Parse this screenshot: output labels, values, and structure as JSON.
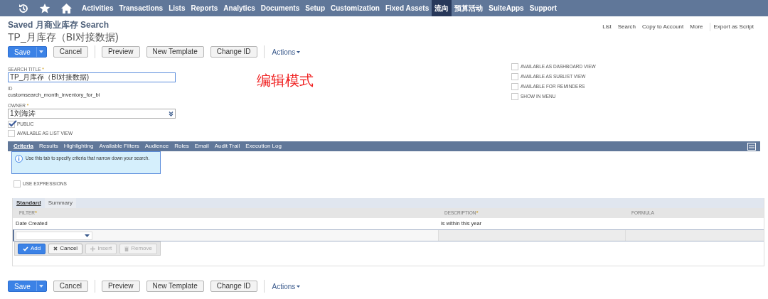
{
  "nav": {
    "icons": [
      {
        "kind": "history"
      },
      {
        "kind": "star"
      },
      {
        "kind": "home"
      }
    ],
    "items": [
      {
        "label": "Activities",
        "selected": false
      },
      {
        "label": "Transactions",
        "selected": false
      },
      {
        "label": "Lists",
        "selected": false
      },
      {
        "label": "Reports",
        "selected": false
      },
      {
        "label": "Analytics",
        "selected": false
      },
      {
        "label": "Documents",
        "selected": false
      },
      {
        "label": "Setup",
        "selected": false
      },
      {
        "label": "Customization",
        "selected": false
      },
      {
        "label": "Fixed Assets",
        "selected": false
      },
      {
        "label": "流向",
        "selected": true
      },
      {
        "label": "预算活动",
        "selected": false
      },
      {
        "label": "SuiteApps",
        "selected": false
      },
      {
        "label": "Support",
        "selected": false
      }
    ]
  },
  "page_title": "Saved 月商业库存 Search",
  "record_name": "TP_月库存（BI对接数据)",
  "header_links": [
    "List",
    "Search",
    "Copy to Account",
    "More",
    "Export as Script"
  ],
  "top_buttons": [
    {
      "kind": "primary",
      "label": "Save"
    },
    {
      "kind": "default",
      "label": "Cancel"
    },
    {
      "kind": "separator"
    },
    {
      "kind": "default",
      "label": "Preview"
    },
    {
      "kind": "default",
      "label": "New Template"
    },
    {
      "kind": "default",
      "label": "Change ID"
    },
    {
      "kind": "separator"
    },
    {
      "kind": "menu",
      "label": "Actions"
    }
  ],
  "fields": {
    "search_title": {
      "label": "SEARCH TITLE",
      "mark": "*",
      "value": "TP_月库存（BI对接数据)"
    },
    "id": {
      "label": "ID",
      "value": "customsearch_month_inventory_for_bi"
    },
    "owner": {
      "label": "OWNER",
      "mark": "*",
      "value": "1刘海涛"
    }
  },
  "left_checks": [
    {
      "label": "PUBLIC",
      "checked": true
    },
    {
      "label": "AVAILABLE AS LIST VIEW",
      "checked": false
    }
  ],
  "right_checks": [
    {
      "label": "AVAILABLE AS DASHBOARD VIEW",
      "checked": false
    },
    {
      "label": "AVAILABLE AS SUBLIST VIEW",
      "checked": false
    },
    {
      "label": "AVAILABLE FOR REMINDERS",
      "checked": false
    },
    {
      "label": "SHOW IN MENU",
      "checked": false
    }
  ],
  "annotation": "编辑模式",
  "tabs": [
    {
      "label": "Criteria",
      "selected": true
    },
    {
      "label": "Results",
      "selected": false
    },
    {
      "label": "Highlighting",
      "selected": false
    },
    {
      "label": "Available Filters",
      "selected": false
    },
    {
      "label": "Audience",
      "selected": false
    },
    {
      "label": "Roles",
      "selected": false
    },
    {
      "label": "Email",
      "selected": false
    },
    {
      "label": "Audit Trail",
      "selected": false
    },
    {
      "label": "Execution Log",
      "selected": false
    }
  ],
  "info": "Use this tab to specify criteria that narrow down your search.",
  "use_expressions": {
    "label": "USE EXPRESSIONS",
    "checked": false
  },
  "subtabs": [
    {
      "label": "Standard",
      "selected": true
    },
    {
      "label": "Summary",
      "selected": false
    }
  ],
  "table": {
    "columns": [
      {
        "label": "FILTER",
        "mark": "*"
      },
      {
        "label": "DESCRIPTION",
        "mark": "*"
      },
      {
        "label": "FORMULA"
      }
    ],
    "rows": [
      [
        "Date Created",
        "is within this year",
        ""
      ]
    ]
  },
  "row_buttons": [
    {
      "kind": "add",
      "label": "Add",
      "disabled": false
    },
    {
      "kind": "cancel",
      "label": "Cancel",
      "disabled": false
    },
    {
      "kind": "insert",
      "label": "Insert",
      "disabled": true
    },
    {
      "kind": "remove",
      "label": "Remove",
      "disabled": true
    }
  ],
  "bottom_buttons": [
    {
      "kind": "primary",
      "label": "Save"
    },
    {
      "kind": "default",
      "label": "Cancel"
    },
    {
      "kind": "separator"
    },
    {
      "kind": "default",
      "label": "Preview"
    },
    {
      "kind": "default",
      "label": "New Template"
    },
    {
      "kind": "default",
      "label": "Change ID"
    },
    {
      "kind": "separator"
    },
    {
      "kind": "menu",
      "label": "Actions"
    }
  ]
}
